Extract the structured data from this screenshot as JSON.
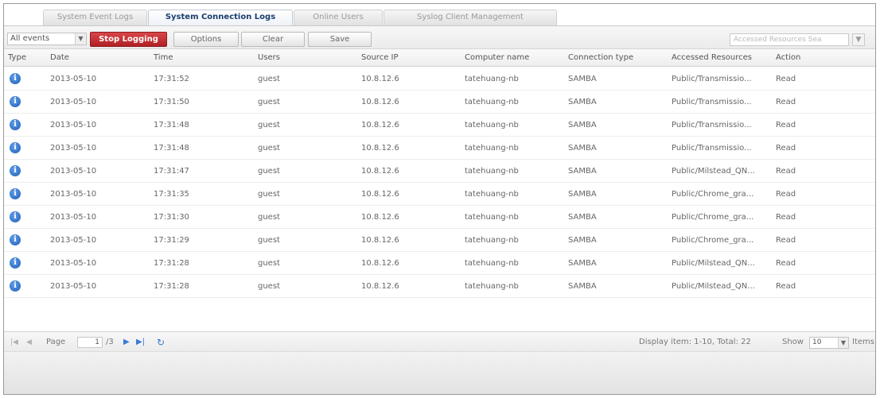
{
  "tabs": [
    {
      "label": "System Event Logs",
      "active": false
    },
    {
      "label": "System Connection Logs",
      "active": true
    },
    {
      "label": "Online Users",
      "active": false
    },
    {
      "label": "Syslog Client Management",
      "active": false
    }
  ],
  "toolbar": {
    "filter_value": "All events",
    "stop_logging_label": "Stop Logging",
    "options_label": "Options",
    "clear_label": "Clear",
    "save_label": "Save",
    "search_placeholder": "Accessed Resources Sea"
  },
  "columns": [
    "Type",
    "Date",
    "Time",
    "Users",
    "Source IP",
    "Computer name",
    "Connection type",
    "Accessed Resources",
    "Action"
  ],
  "rows": [
    {
      "date": "2013-05-10",
      "time": "17:31:52",
      "user": "guest",
      "ip": "10.8.12.6",
      "computer": "tatehuang-nb",
      "conn": "SAMBA",
      "resource": "Public/Transmissio...",
      "action": "Read"
    },
    {
      "date": "2013-05-10",
      "time": "17:31:50",
      "user": "guest",
      "ip": "10.8.12.6",
      "computer": "tatehuang-nb",
      "conn": "SAMBA",
      "resource": "Public/Transmissio...",
      "action": "Read"
    },
    {
      "date": "2013-05-10",
      "time": "17:31:48",
      "user": "guest",
      "ip": "10.8.12.6",
      "computer": "tatehuang-nb",
      "conn": "SAMBA",
      "resource": "Public/Transmissio...",
      "action": "Read"
    },
    {
      "date": "2013-05-10",
      "time": "17:31:48",
      "user": "guest",
      "ip": "10.8.12.6",
      "computer": "tatehuang-nb",
      "conn": "SAMBA",
      "resource": "Public/Transmissio...",
      "action": "Read"
    },
    {
      "date": "2013-05-10",
      "time": "17:31:47",
      "user": "guest",
      "ip": "10.8.12.6",
      "computer": "tatehuang-nb",
      "conn": "SAMBA",
      "resource": "Public/Milstead_QN...",
      "action": "Read"
    },
    {
      "date": "2013-05-10",
      "time": "17:31:35",
      "user": "guest",
      "ip": "10.8.12.6",
      "computer": "tatehuang-nb",
      "conn": "SAMBA",
      "resource": "Public/Chrome_gra...",
      "action": "Read"
    },
    {
      "date": "2013-05-10",
      "time": "17:31:30",
      "user": "guest",
      "ip": "10.8.12.6",
      "computer": "tatehuang-nb",
      "conn": "SAMBA",
      "resource": "Public/Chrome_gra...",
      "action": "Read"
    },
    {
      "date": "2013-05-10",
      "time": "17:31:29",
      "user": "guest",
      "ip": "10.8.12.6",
      "computer": "tatehuang-nb",
      "conn": "SAMBA",
      "resource": "Public/Chrome_gra...",
      "action": "Read"
    },
    {
      "date": "2013-05-10",
      "time": "17:31:28",
      "user": "guest",
      "ip": "10.8.12.6",
      "computer": "tatehuang-nb",
      "conn": "SAMBA",
      "resource": "Public/Milstead_QN...",
      "action": "Read"
    },
    {
      "date": "2013-05-10",
      "time": "17:31:28",
      "user": "guest",
      "ip": "10.8.12.6",
      "computer": "tatehuang-nb",
      "conn": "SAMBA",
      "resource": "Public/Milstead_QN...",
      "action": "Read"
    }
  ],
  "row_icon": "info-icon",
  "pager": {
    "page_label": "Page",
    "page_value": "1",
    "page_total": "/3",
    "display_text": "Display item: 1-10, Total: 22",
    "show_label": "Show",
    "show_value": "10",
    "items_label": "Items"
  },
  "colors": {
    "accent": "#1f5fb8",
    "stop_button": "#c1272b",
    "active_tab_text": "#1a3d6e"
  }
}
